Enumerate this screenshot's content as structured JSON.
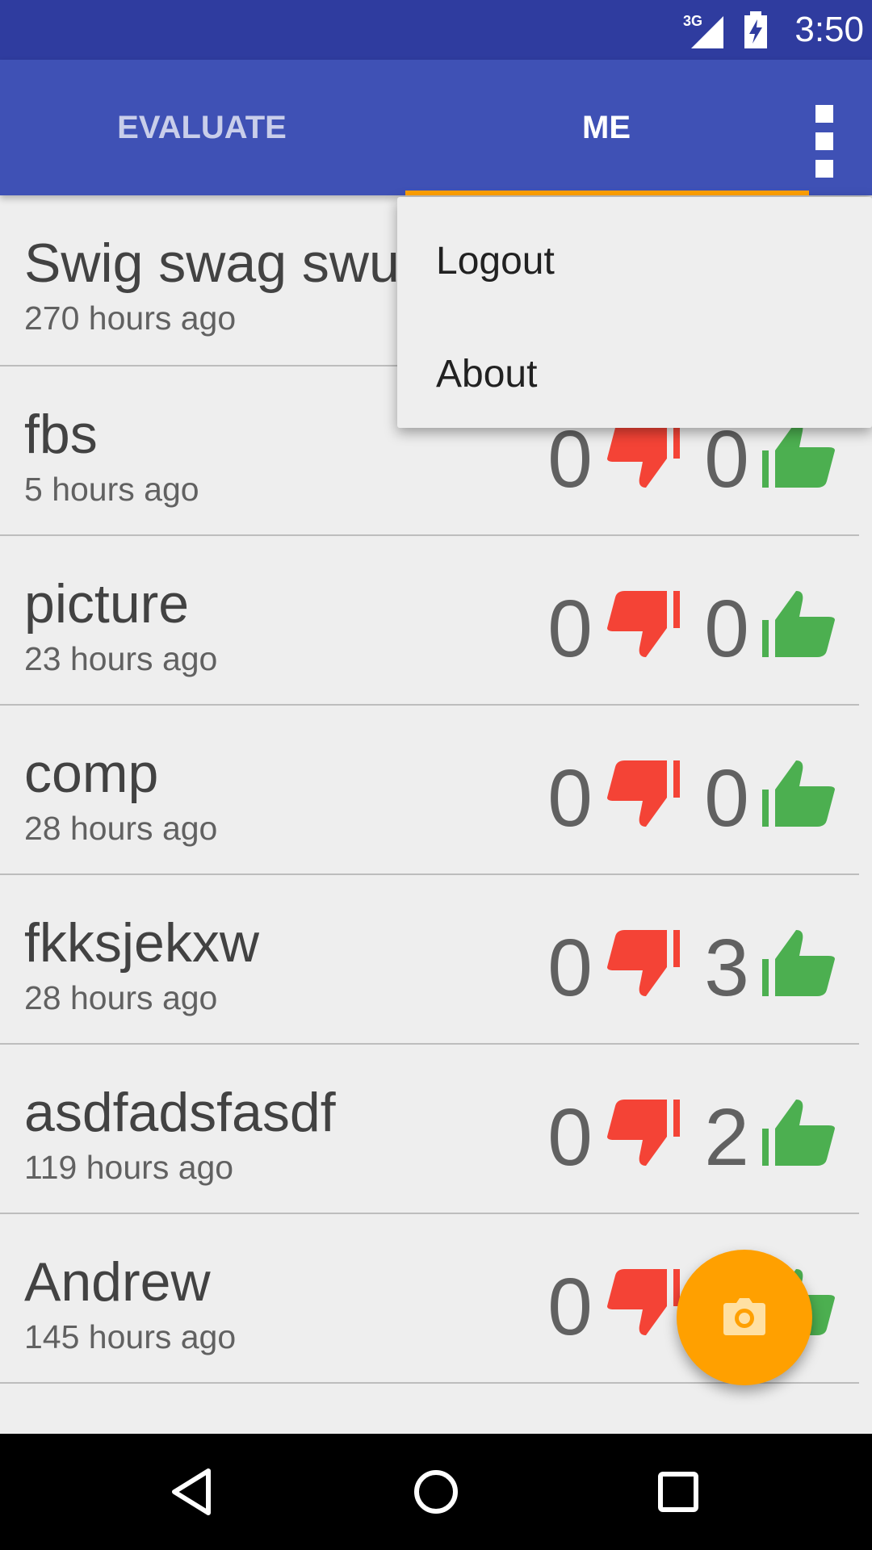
{
  "status_bar": {
    "time": "3:50",
    "network_label": "3G",
    "icons": [
      "signal-3g-icon",
      "battery-charging-icon"
    ]
  },
  "tabs": [
    {
      "label": "EVALUATE",
      "selected": false
    },
    {
      "label": "ME",
      "selected": true
    }
  ],
  "menu": {
    "items": [
      "Logout",
      "About"
    ]
  },
  "posts": [
    {
      "title": "Swig swag swu",
      "time": "270 hours ago",
      "down": "",
      "up": ""
    },
    {
      "title": "fbs",
      "time": "5 hours ago",
      "down": "0",
      "up": "0"
    },
    {
      "title": "picture",
      "time": "23 hours ago",
      "down": "0",
      "up": "0"
    },
    {
      "title": "comp",
      "time": "28 hours ago",
      "down": "0",
      "up": "0"
    },
    {
      "title": "fkksjekxw",
      "time": "28 hours ago",
      "down": "0",
      "up": "3"
    },
    {
      "title": "asdfadsfasdf",
      "time": "119 hours ago",
      "down": "0",
      "up": "2"
    },
    {
      "title": "Andrew",
      "time": "145 hours ago",
      "down": "0",
      "up": ""
    }
  ],
  "colors": {
    "status_bar": "#2F3C9F",
    "app_bar": "#3F51B5",
    "accent": "#FFA000",
    "thumb_down": "#F44336",
    "thumb_up": "#4CAF50"
  },
  "fab_icon": "camera-icon",
  "nav_icons": [
    "back-icon",
    "home-icon",
    "recents-icon"
  ]
}
